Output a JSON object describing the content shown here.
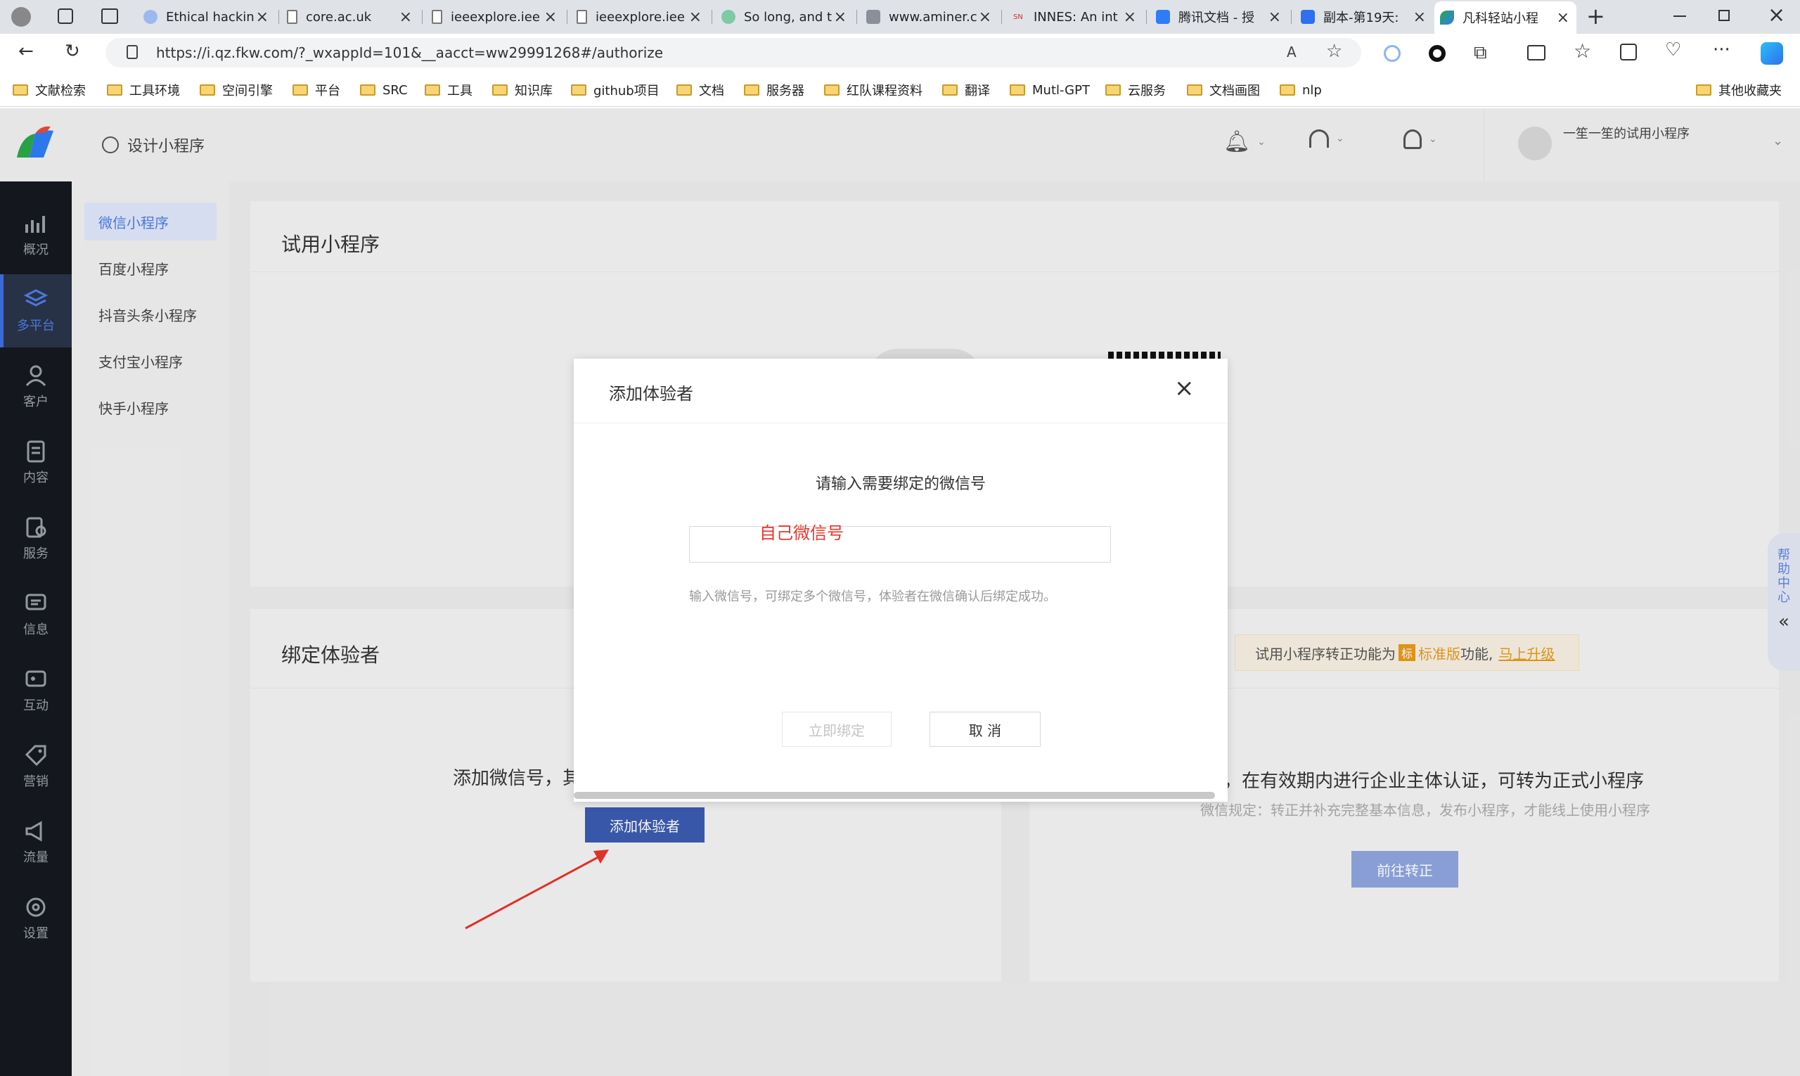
{
  "browser": {
    "tabs": [
      {
        "title": "Ethical hackin",
        "icon": "cloud-icon"
      },
      {
        "title": "core.ac.uk",
        "icon": "page-icon"
      },
      {
        "title": "ieeexplore.iee",
        "icon": "page-icon"
      },
      {
        "title": "ieeexplore.iee",
        "icon": "page-icon"
      },
      {
        "title": "So long, and t",
        "icon": "swirl-icon"
      },
      {
        "title": "www.aminer.c",
        "icon": "aminer-icon"
      },
      {
        "title": "INNES: An int",
        "icon": "sn-icon"
      },
      {
        "title": "腾讯文档 - 授",
        "icon": "tencent-docs-icon"
      },
      {
        "title": "副本-第19天:",
        "icon": "doc-icon"
      },
      {
        "title": "凡科轻站小程",
        "icon": "fkw-icon"
      }
    ],
    "sn_label": "SN",
    "url": "https://i.qz.fkw.com/?_wxappId=101&__aacct=ww29991268#/authorize",
    "bookmarks": [
      "文献检索",
      "工具环境",
      "空间引擎",
      "平台",
      "SRC",
      "工具",
      "知识库",
      "github项目",
      "文档",
      "服务器",
      "红队课程资料",
      "翻译",
      "Mutl-GPT",
      "云服务",
      "文档画图",
      "nlp"
    ],
    "other_bookmarks": "其他收藏夹"
  },
  "header": {
    "design_label": "设计小程序",
    "account_name": "一笙一笙的试用小程序"
  },
  "leftnav": [
    {
      "label": "概况",
      "icon": "chart-icon"
    },
    {
      "label": "多平台",
      "icon": "layers-icon"
    },
    {
      "label": "客户",
      "icon": "user-icon"
    },
    {
      "label": "内容",
      "icon": "document-icon"
    },
    {
      "label": "服务",
      "icon": "service-icon"
    },
    {
      "label": "信息",
      "icon": "message-icon"
    },
    {
      "label": "互动",
      "icon": "gamepad-icon"
    },
    {
      "label": "营销",
      "icon": "tag-icon"
    },
    {
      "label": "流量",
      "icon": "megaphone-icon"
    },
    {
      "label": "设置",
      "icon": "gear-icon"
    }
  ],
  "subnav": [
    "微信小程序",
    "百度小程序",
    "抖音头条小程序",
    "支付宝小程序",
    "快手小程序"
  ],
  "main": {
    "trial_title": "试用小程序",
    "bind_title": "绑定体验者",
    "add_text": "添加微信号，其",
    "add_tester_button": "添加体验者",
    "upgrade_notice_prefix": "试用小程序转正功能为",
    "upgrade_badge": "标",
    "upgrade_notice_std": "标准版",
    "upgrade_notice_suffix": "功能,",
    "upgrade_link": "马上升级",
    "convert_text": "后，在有效期内进行企业主体认证，可转为正式小程序",
    "convert_subtext": "微信规定：转正并补充完整基本信息，发布小程序，才能线上使用小程序",
    "convert_button": "前往转正"
  },
  "modal": {
    "title": "添加体验者",
    "prompt": "请输入需要绑定的微信号",
    "input_value": "",
    "annotation": "自己微信号",
    "hint": "输入微信号，可绑定多个微信号，体验者在微信确认后绑定成功。",
    "bind_button": "立即绑定",
    "cancel_button": "取 消"
  },
  "help_tab": [
    "帮",
    "助",
    "中",
    "心"
  ],
  "colors": {
    "primary": "#4e7de6",
    "annotation_red": "#e8352b",
    "nav_dark": "#151920",
    "upgrade_orange": "#e69a1c"
  }
}
